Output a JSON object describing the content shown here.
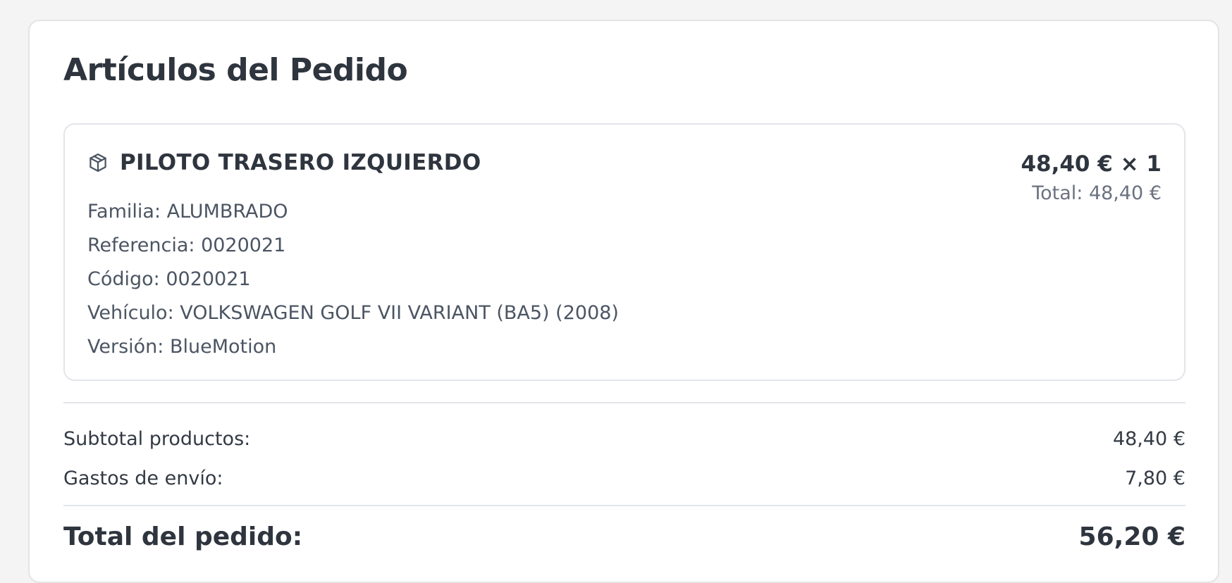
{
  "order": {
    "title": "Artículos del Pedido",
    "item": {
      "icon": "package-icon",
      "name": "PILOTO TRASERO IZQUIERDO",
      "details": [
        "Familia: ALUMBRADO",
        "Referencia: 0020021",
        "Código: 0020021",
        "Vehículo: VOLKSWAGEN GOLF VII VARIANT (BA5) (2008)",
        "Versión: BlueMotion"
      ],
      "unit_price_qty": "48,40 € × 1",
      "line_total": "Total: 48,40 €"
    },
    "summary": {
      "subtotal_label": "Subtotal productos:",
      "subtotal_value": "48,40 €",
      "shipping_label": "Gastos de envío:",
      "shipping_value": "7,80 €",
      "total_label": "Total del pedido:",
      "total_value": "56,20 €"
    }
  }
}
